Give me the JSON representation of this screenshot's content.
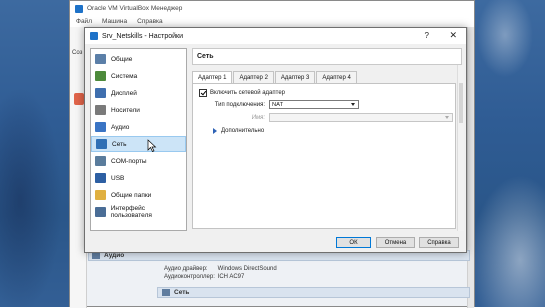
{
  "manager": {
    "title": "Oracle VM VirtualBox Менеджер",
    "menu": [
      "Файл",
      "Машина",
      "Справка"
    ],
    "left_label": "Соз",
    "audio": {
      "header": "Аудио",
      "rows": [
        {
          "key": "Аудио драйвер:",
          "value": "Windows DirectSound"
        },
        {
          "key": "Аудиоконтроллер:",
          "value": "ICH AC97"
        }
      ]
    },
    "network": {
      "header": "Сеть"
    }
  },
  "dialog": {
    "title": "Srv_Netskills - Настройки",
    "help_label": "?",
    "close_label": "✕",
    "categories": [
      {
        "label": "Общие",
        "icon": "general-icon",
        "color": "#5b7fa8",
        "selected": false
      },
      {
        "label": "Система",
        "icon": "system-icon",
        "color": "#4d8a3b",
        "selected": false
      },
      {
        "label": "Дисплей",
        "icon": "display-icon",
        "color": "#3f6fae",
        "selected": false
      },
      {
        "label": "Носители",
        "icon": "storage-icon",
        "color": "#7a7a7a",
        "selected": false
      },
      {
        "label": "Аудио",
        "icon": "audio-icon",
        "color": "#3a74c4",
        "selected": false
      },
      {
        "label": "Сеть",
        "icon": "network-icon",
        "color": "#2f6fb5",
        "selected": true
      },
      {
        "label": "COM-порты",
        "icon": "serial-port-icon",
        "color": "#5a7c9c",
        "selected": false
      },
      {
        "label": "USB",
        "icon": "usb-icon",
        "color": "#2d5fa3",
        "selected": false
      },
      {
        "label": "Общие папки",
        "icon": "shared-folders-icon",
        "color": "#e0b040",
        "selected": false
      },
      {
        "label": "Интерфейс пользователя",
        "icon": "user-interface-icon",
        "color": "#4a6d96",
        "selected": false
      }
    ],
    "page_title": "Сеть",
    "tabs": [
      "Адаптер 1",
      "Адаптер 2",
      "Адаптер 3",
      "Адаптер 4"
    ],
    "active_tab": 0,
    "enable_adapter": {
      "label": "Включить сетевой адаптер",
      "checked": true
    },
    "attached_to": {
      "label": "Тип подключения:",
      "value": "NAT"
    },
    "name": {
      "label": "Имя:",
      "value": ""
    },
    "advanced_label": "Дополнительно",
    "buttons": {
      "ok": "ОК",
      "cancel": "Отмена",
      "help": "Справка"
    }
  }
}
